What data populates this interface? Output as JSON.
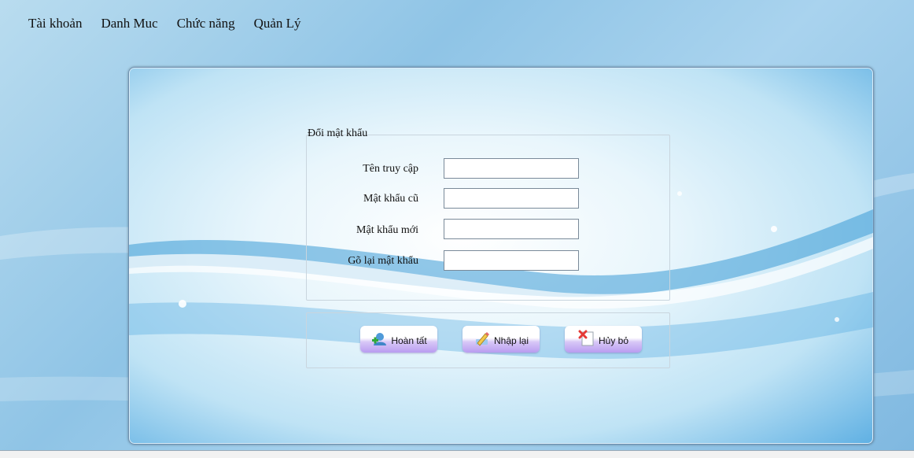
{
  "menu": [
    "Tài khoản",
    "Danh Muc",
    "Chức năng",
    "Quản Lý"
  ],
  "form": {
    "title": "Đổi mật khẩu",
    "fields": [
      {
        "label": "Tên truy cập",
        "value": ""
      },
      {
        "label": "Mật khẩu cũ",
        "value": ""
      },
      {
        "label": "Mật khẩu mới",
        "value": ""
      },
      {
        "label": "Gõ lại mật khẩu",
        "value": ""
      }
    ]
  },
  "buttons": {
    "finish": {
      "label": "Hoàn tất",
      "icon": "add-user-icon"
    },
    "reset": {
      "label": "Nhập lại",
      "icon": "pencil-icon"
    },
    "cancel": {
      "label": "Hủy bỏ",
      "icon": "cancel-icon"
    }
  },
  "colors": {
    "accent": "#5fb0e3",
    "button_gradient_bottom": "#b99cf0"
  }
}
